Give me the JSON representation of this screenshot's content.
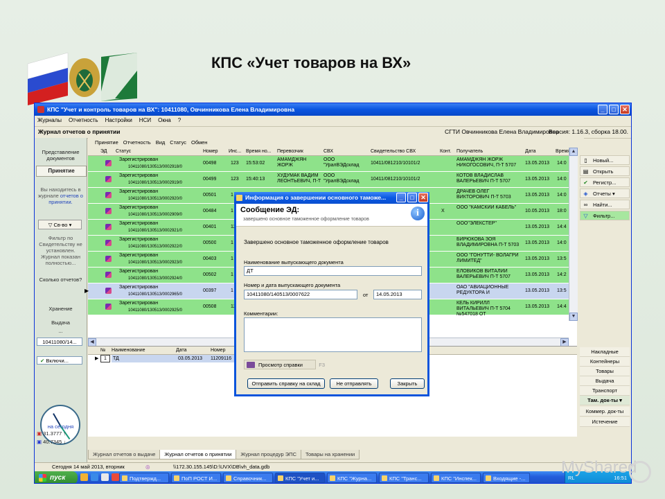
{
  "slide": {
    "title": "КПС «Учет товаров на ВХ»"
  },
  "window": {
    "title": "КПС \"Учет и контроль товаров на ВХ\": 10411080, Овчинникова Елена Владимировна",
    "controls": [
      "_",
      "□",
      "✕"
    ]
  },
  "menu": [
    "Журналы",
    "Отчетность",
    "Настройки",
    "НСИ",
    "Окна",
    "?"
  ],
  "journal_header": {
    "title": "Журнал отчетов о принятии",
    "user": "СГТИ Овчинникова Елена Владимировна",
    "version": "Версия: 1.16.3, сборка 18.00."
  },
  "left_panel": {
    "docs_label": "Представление документов",
    "active_section": "Принятие",
    "location_note": "Вы находитесь в журнале",
    "location_link": "отчетов о принятии.",
    "filter_button": "Св-во",
    "filter_note": "Фильтр по Свидетельству не установлен. Журнал показан полностью...",
    "count_question": "Сколько отчетов?",
    "storage_label": "Хранение",
    "issue_label": "Выдача",
    "more_label": "...",
    "code_value": "10411080/14...",
    "status_value": "Включи...",
    "today_label": "на сегодня",
    "usd_rate": "31.3777 ↑",
    "eur_rate": "40.7345 ↓"
  },
  "tabs_row": [
    "Принятие",
    "Отчетность",
    "Вид",
    "Статус",
    "Обмен"
  ],
  "table": {
    "columns": [
      "ЭД",
      "Статус",
      "Номер",
      "Инс...",
      "Время но...",
      "Перевозчик",
      "СВХ",
      "Свидетельство СВХ",
      "Конт.",
      "Получатель",
      "Дата",
      "Время"
    ],
    "rows": [
      {
        "status": "Зарегистрирован",
        "doc": "10411080/130513/0002918/0",
        "num": "00498",
        "ins": "123",
        "time": "15:53:02",
        "carrier": "АМАМДЖЯН ЖОРЖ",
        "svh": "ООО \"УралВЭДсклад",
        "cert": "10411/081210/10101/2",
        "cont": "",
        "recipient": "АМАМДЖЯН ЖОРЖ НИКОГОСОВИЧ, П-Т 5707",
        "date": "13.05.2013",
        "t2": "14:0"
      },
      {
        "status": "Зарегистрирован",
        "doc": "10411080/130513/0002919/0",
        "num": "00499",
        "ins": "123",
        "time": "15:40:13",
        "carrier": "ХУДУМАК ВАДИМ ЛЕОНТЬЕВИЧ, П-Т",
        "svh": "ООО \"УралВЭДсклад",
        "cert": "10411/081210/10101/2",
        "cont": "",
        "recipient": "КОТОВ ВЛАДИСЛАВ ВАЛЕРЬЕВИЧ П-Т 5707",
        "date": "13.05.2013",
        "t2": "14:0"
      },
      {
        "status": "Зарегистрирован",
        "doc": "10411080/130513/0002920/0",
        "num": "00501",
        "ins": "1",
        "time": "",
        "carrier": "",
        "svh": "",
        "cert": "",
        "cont": "",
        "recipient": "ДРАЧЕВ ОЛЕГ ВИКТОРОВИЧ П-Т 5703",
        "date": "13.05.2013",
        "t2": "14:0"
      },
      {
        "status": "Зарегистрирован",
        "doc": "10411080/130513/0002909/0",
        "num": "00484",
        "ins": "1",
        "time": "",
        "carrier": "",
        "svh": "",
        "cert": "/8",
        "cont": "X",
        "recipient": "ООО \"КАМСКИЙ КАБЕЛЬ\"",
        "date": "10.05.2013",
        "t2": "18:0"
      },
      {
        "status": "Зарегистрирован",
        "doc": "10411080/130513/0002921/0",
        "num": "00401",
        "ins": "12",
        "time": "",
        "carrier": "",
        "svh": "",
        "cert": "",
        "cont": "",
        "recipient": "ООО\"ЭЛЕКСТЕР\"",
        "date": "13.05.2013",
        "t2": "14:4"
      },
      {
        "status": "Зарегистрирован",
        "doc": "10411080/130513/0002922/0",
        "num": "00500",
        "ins": "1",
        "time": "",
        "carrier": "",
        "svh": "",
        "cert": "",
        "cont": "",
        "recipient": "БИРЮКОВА ЗОЯ ВЛАДИМИРОВНА П-Т 5703",
        "date": "13.05.2013",
        "t2": "14:0"
      },
      {
        "status": "Зарегистрирован",
        "doc": "10411080/130513/0002923/0",
        "num": "00403",
        "ins": "1",
        "time": "",
        "carrier": "",
        "svh": "",
        "cert": "",
        "cont": "",
        "recipient": "ООО \"ГОНУТТИ- ВОЛАГРИ ЛИМИТЕД\"",
        "date": "13.05.2013",
        "t2": "13:5"
      },
      {
        "status": "Зарегистрирован",
        "doc": "10411080/130513/0002924/0",
        "num": "00502",
        "ins": "1",
        "time": "",
        "carrier": "",
        "svh": "",
        "cert": "",
        "cont": "",
        "recipient": "ЕЛОВИКОВ ВИТАЛИЙ ВАЛЕРЬЕВИЧ П-Т 5707",
        "date": "13.05.2013",
        "t2": "14:2"
      },
      {
        "status": "Зарегистрирован",
        "doc": "10411080/130513/0002965/0",
        "num": "00397",
        "ins": "1",
        "time": "",
        "carrier": "",
        "svh": "",
        "cert": "",
        "cont": "",
        "recipient": "ОАО \"АВИАЦИОННЫЕ РЕДУКТОРА И",
        "date": "13.05.2013",
        "t2": "13:5"
      },
      {
        "status": "Зарегистрирован",
        "doc": "10411080/130513/0002925/0",
        "num": "00508",
        "ins": "12",
        "time": "",
        "carrier": "",
        "svh": "",
        "cert": "",
        "cont": "",
        "recipient": "КЕЛЬ КИРИЛЛ ВИТАЛЬЕВИЧ П-Т 5704 №547018 ОТ",
        "date": "13.05.2013",
        "t2": "14:4"
      }
    ]
  },
  "right_actions": [
    "Новый...",
    "Открыть",
    "Регистр...",
    "Отчеты ▾",
    "Найти...",
    "Фильтр..."
  ],
  "detail": {
    "columns": [
      "№",
      "Наименование",
      "Дата",
      "Номер"
    ],
    "row": {
      "n": "1",
      "name": "ТД",
      "date": "03.05.2013",
      "num": "11209116"
    }
  },
  "right_list": [
    "Накладные",
    "Контейнеры",
    "Товары",
    "Выдача",
    "Транспорт",
    "Там. док-ты ▾",
    "Коммер. док-ты",
    "Истечение"
  ],
  "bottom_tabs": [
    "Журнал отчетов о выдаче",
    "Журнал отчетов о принятии",
    "Журнал процедур ЭПС",
    "Товары на хранении"
  ],
  "statusbar": {
    "date": "Сегодня 14 май 2013, вторник",
    "path": "\\\\172.30.155.145\\D:\\UVX\\DB\\vh_data.gdb"
  },
  "taskbar": {
    "start": "пуск",
    "tasks": [
      "Подтвержд...",
      "ПоП РОСТ И...",
      "Справочник...",
      "КПС \"Учет и...",
      "КПС \"Журна...",
      "КПС \"Транс...",
      "КПС \"Инспек...",
      "Входящие -..."
    ],
    "lang": "RL",
    "clock": "16:51"
  },
  "dialog": {
    "title": "Информация о завершении основного таможе...",
    "heading": "Сообщение ЭД:",
    "subheading": "завершено основное таможенное оформление товаров",
    "message": "Завершено основное таможенное оформление товаров",
    "doc_name_label": "Наименование выпускающего документа",
    "doc_name_value": "ДТ",
    "doc_num_label": "Номер и дата выпускающего документа",
    "doc_num_value": "10411080/140513/0007622",
    "from_label": "от",
    "doc_date_value": "14.05.2013",
    "comment_label": "Комментарии:",
    "preview_btn": "Просмотр справки",
    "preview_key": "F3",
    "send_btn": "Отправить справку на склад",
    "nosend_btn": "Не отправлять",
    "close_btn": "Закрыть"
  },
  "watermark": "MyShared"
}
